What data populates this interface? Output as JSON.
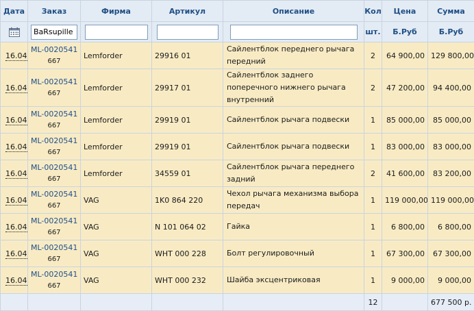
{
  "headers": {
    "date": "Дата",
    "order": "Заказ",
    "firm": "Фирма",
    "article": "Артикул",
    "desc": "Описание",
    "qty": "Кол",
    "price": "Цена",
    "sum": "Сумма"
  },
  "filters": {
    "order_value": "BaRsupille",
    "firm_value": "",
    "article_value": "",
    "desc_value": "",
    "qty_unit": "шт.",
    "price_unit": "Б.Руб",
    "sum_unit": "Б.Руб"
  },
  "icons": {
    "date_filter": "calendar-icon"
  },
  "colors": {
    "row_bg": "#f8ebc4",
    "header_bg": "#e3ebf5",
    "link": "#1d4e8c"
  },
  "rows": [
    {
      "date": "16.04",
      "order": "ML-0020541",
      "order_sub": "667",
      "firm": "Lemforder",
      "article": "29916 01",
      "desc": "Сайлентблок переднего рычага передний",
      "qty": "2",
      "price": "64 900,00",
      "sum": "129 800,00"
    },
    {
      "date": "16.04",
      "order": "ML-0020541",
      "order_sub": "667",
      "firm": "Lemforder",
      "article": "29917 01",
      "desc": "Сайлентблок заднего поперечного нижнего рычага внутренний",
      "qty": "2",
      "price": "47 200,00",
      "sum": "94 400,00"
    },
    {
      "date": "16.04",
      "order": "ML-0020541",
      "order_sub": "667",
      "firm": "Lemforder",
      "article": "29919 01",
      "desc": "Сайлентблок рычага подвески",
      "qty": "1",
      "price": "85 000,00",
      "sum": "85 000,00"
    },
    {
      "date": "16.04",
      "order": "ML-0020541",
      "order_sub": "667",
      "firm": "Lemforder",
      "article": "29919 01",
      "desc": "Сайлентблок рычага подвески",
      "qty": "1",
      "price": "83 000,00",
      "sum": "83 000,00"
    },
    {
      "date": "16.04",
      "order": "ML-0020541",
      "order_sub": "667",
      "firm": "Lemforder",
      "article": "34559 01",
      "desc": "Сайлентблок рычага переднего задний",
      "qty": "2",
      "price": "41 600,00",
      "sum": "83 200,00"
    },
    {
      "date": "16.04",
      "order": "ML-0020541",
      "order_sub": "667",
      "firm": "VAG",
      "article": "1K0 864 220",
      "desc": "Чехол рычага механизма выбора передач",
      "qty": "1",
      "price": "119 000,00",
      "sum": "119 000,00"
    },
    {
      "date": "16.04",
      "order": "ML-0020541",
      "order_sub": "667",
      "firm": "VAG",
      "article": "N 101 064 02",
      "desc": "Гайка",
      "qty": "1",
      "price": "6 800,00",
      "sum": "6 800,00"
    },
    {
      "date": "16.04",
      "order": "ML-0020541",
      "order_sub": "667",
      "firm": "VAG",
      "article": "WHT 000 228",
      "desc": "Болт регулировочный",
      "qty": "1",
      "price": "67 300,00",
      "sum": "67 300,00"
    },
    {
      "date": "16.04",
      "order": "ML-0020541",
      "order_sub": "667",
      "firm": "VAG",
      "article": "WHT 000 232",
      "desc": "Шайба эксцентриковая",
      "qty": "1",
      "price": "9 000,00",
      "sum": "9 000,00"
    }
  ],
  "totals": {
    "qty": "12",
    "sum": "677 500 р."
  }
}
